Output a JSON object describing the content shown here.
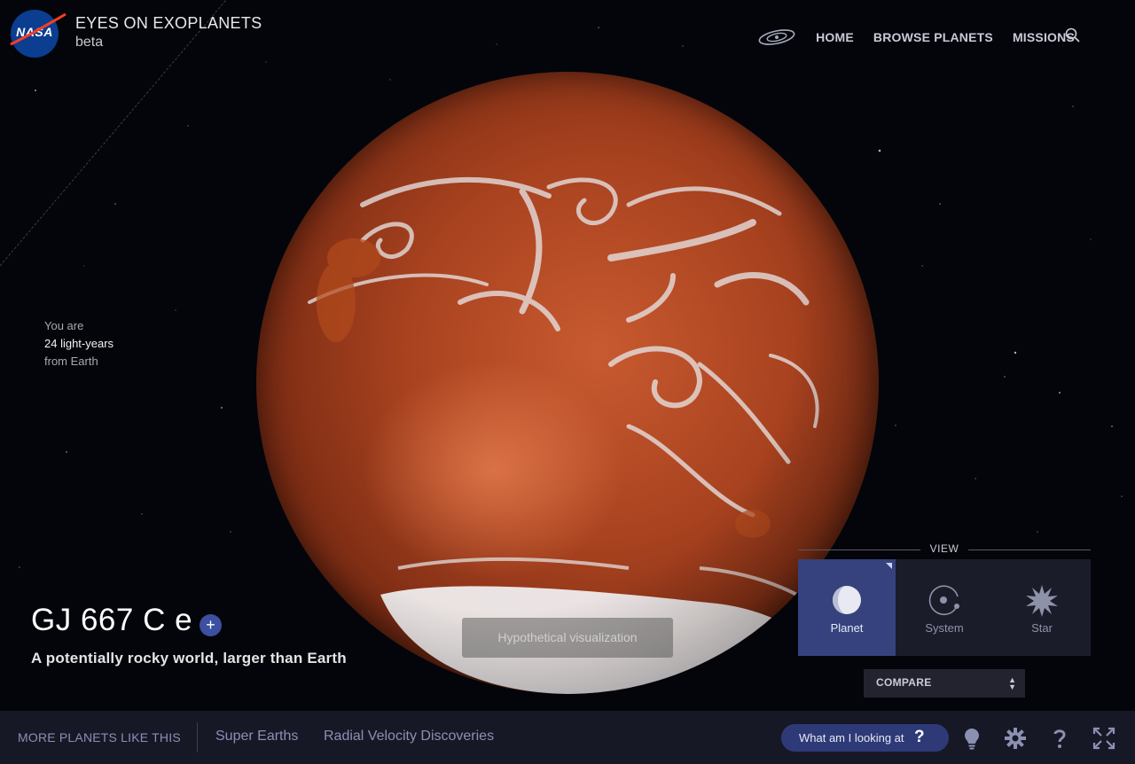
{
  "header": {
    "logo_text": "NASA",
    "title": "EYES ON EXOPLANETS",
    "subtitle": "beta"
  },
  "nav": {
    "items": [
      {
        "label": "HOME",
        "icon": "galaxy-icon"
      },
      {
        "label": "BROWSE PLANETS"
      },
      {
        "label": "MISSIONS"
      }
    ],
    "search_icon": "search-icon"
  },
  "distance": {
    "line1": "You are",
    "line2": "24 light-years",
    "line3": "from Earth"
  },
  "planet": {
    "name": "GJ 667 C e",
    "add_label": "+",
    "description": "A potentially rocky world, larger than Earth",
    "note": "Hypothetical visualization"
  },
  "view": {
    "label": "VIEW",
    "options": [
      {
        "label": "Planet",
        "icon": "planet-icon",
        "active": true
      },
      {
        "label": "System",
        "icon": "system-icon",
        "active": false
      },
      {
        "label": "Star",
        "icon": "star-icon",
        "active": false
      }
    ],
    "compare_label": "COMPARE"
  },
  "bottom": {
    "more_label": "MORE PLANETS LIKE THIS",
    "categories": [
      "Super Earths",
      "Radial Velocity Discoveries"
    ],
    "what_label": "What am I looking at",
    "what_icon": "?",
    "icons": [
      "lightbulb-icon",
      "settings-icon",
      "help-icon",
      "fullscreen-icon"
    ]
  },
  "colors": {
    "accent": "#35427e",
    "nav_text": "#c8cbd8",
    "bottom_bar": "#171826"
  }
}
